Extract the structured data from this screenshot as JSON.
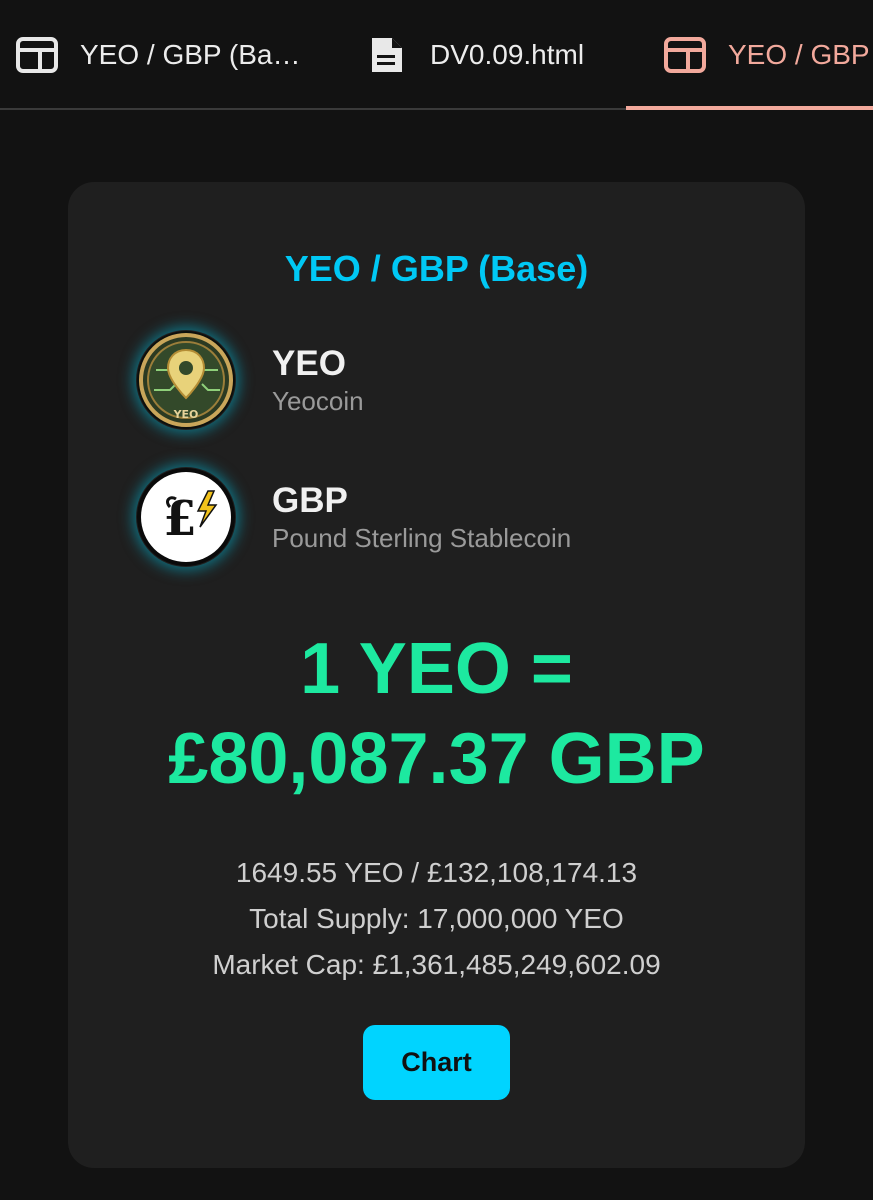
{
  "tabs": [
    {
      "label": "YEO / GBP (Ba…",
      "icon": "browser-window-icon",
      "active": false
    },
    {
      "label": "DV0.09.html",
      "icon": "document-icon",
      "active": false
    },
    {
      "label": "YEO / GBP",
      "icon": "browser-window-icon",
      "active": true
    }
  ],
  "card": {
    "title": "YEO / GBP (Base)",
    "base_token": {
      "symbol": "YEO",
      "name": "Yeocoin",
      "logo_text": "YEO",
      "icon": "location-pin-coin-icon"
    },
    "quote_token": {
      "symbol": "GBP",
      "name": "Pound Sterling Stablecoin",
      "icon": "pound-lightning-icon"
    },
    "rate_line1": "1 YEO =",
    "rate_line2": "£80,087.37 GBP",
    "reserves": "1649.55 YEO / £132,108,174.13",
    "total_supply": "Total Supply: 17,000,000 YEO",
    "market_cap": "Market Cap: £1,361,485,249,602.09",
    "chart_button": "Chart"
  },
  "colors": {
    "accent_title": "#00c8f5",
    "rate_green": "#1de9a0",
    "button_cyan": "#00d4ff",
    "active_tab": "#f2a99c"
  }
}
